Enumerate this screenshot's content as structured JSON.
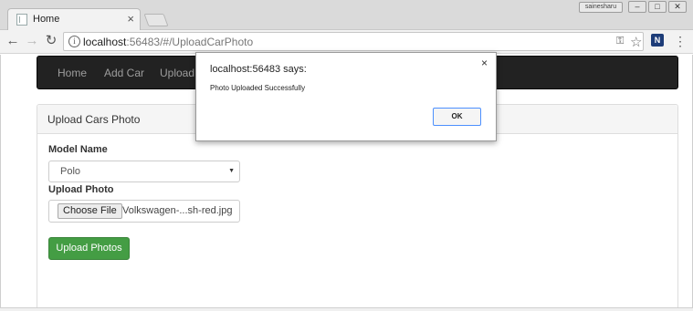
{
  "browser": {
    "tab_title": "Home",
    "tab_close": "×",
    "user_badge": "sainesharu",
    "window_controls": {
      "minimize": "–",
      "restore": "□",
      "close": "✕"
    },
    "address": {
      "host": "localhost",
      "rest": ":56483/#/UploadCarPhoto"
    },
    "icons": {
      "back": "←",
      "forward": "→",
      "reload": "↻",
      "info": "i",
      "key": "⚿",
      "star": "☆",
      "extension": "N",
      "menu": "⋮"
    }
  },
  "navbar": {
    "links": [
      {
        "label": "Home"
      },
      {
        "label": "Add Car"
      },
      {
        "label": "Upload C"
      }
    ]
  },
  "panel": {
    "title": "Upload Cars Photo",
    "model_label": "Model Name",
    "model_value": "Polo",
    "photo_label": "Upload Photo",
    "file_button": "Choose File",
    "file_name": "Volkswagen-...sh-red.jpg",
    "upload_button": "Upload Photos"
  },
  "dialog": {
    "title": "localhost:56483 says:",
    "close": "×",
    "message": "Photo Uploaded Successfully",
    "ok_label": "OK"
  },
  "colors": {
    "navbar_bg": "#222222",
    "success_button": "#449d44",
    "dialog_focus": "#4d90fe"
  }
}
